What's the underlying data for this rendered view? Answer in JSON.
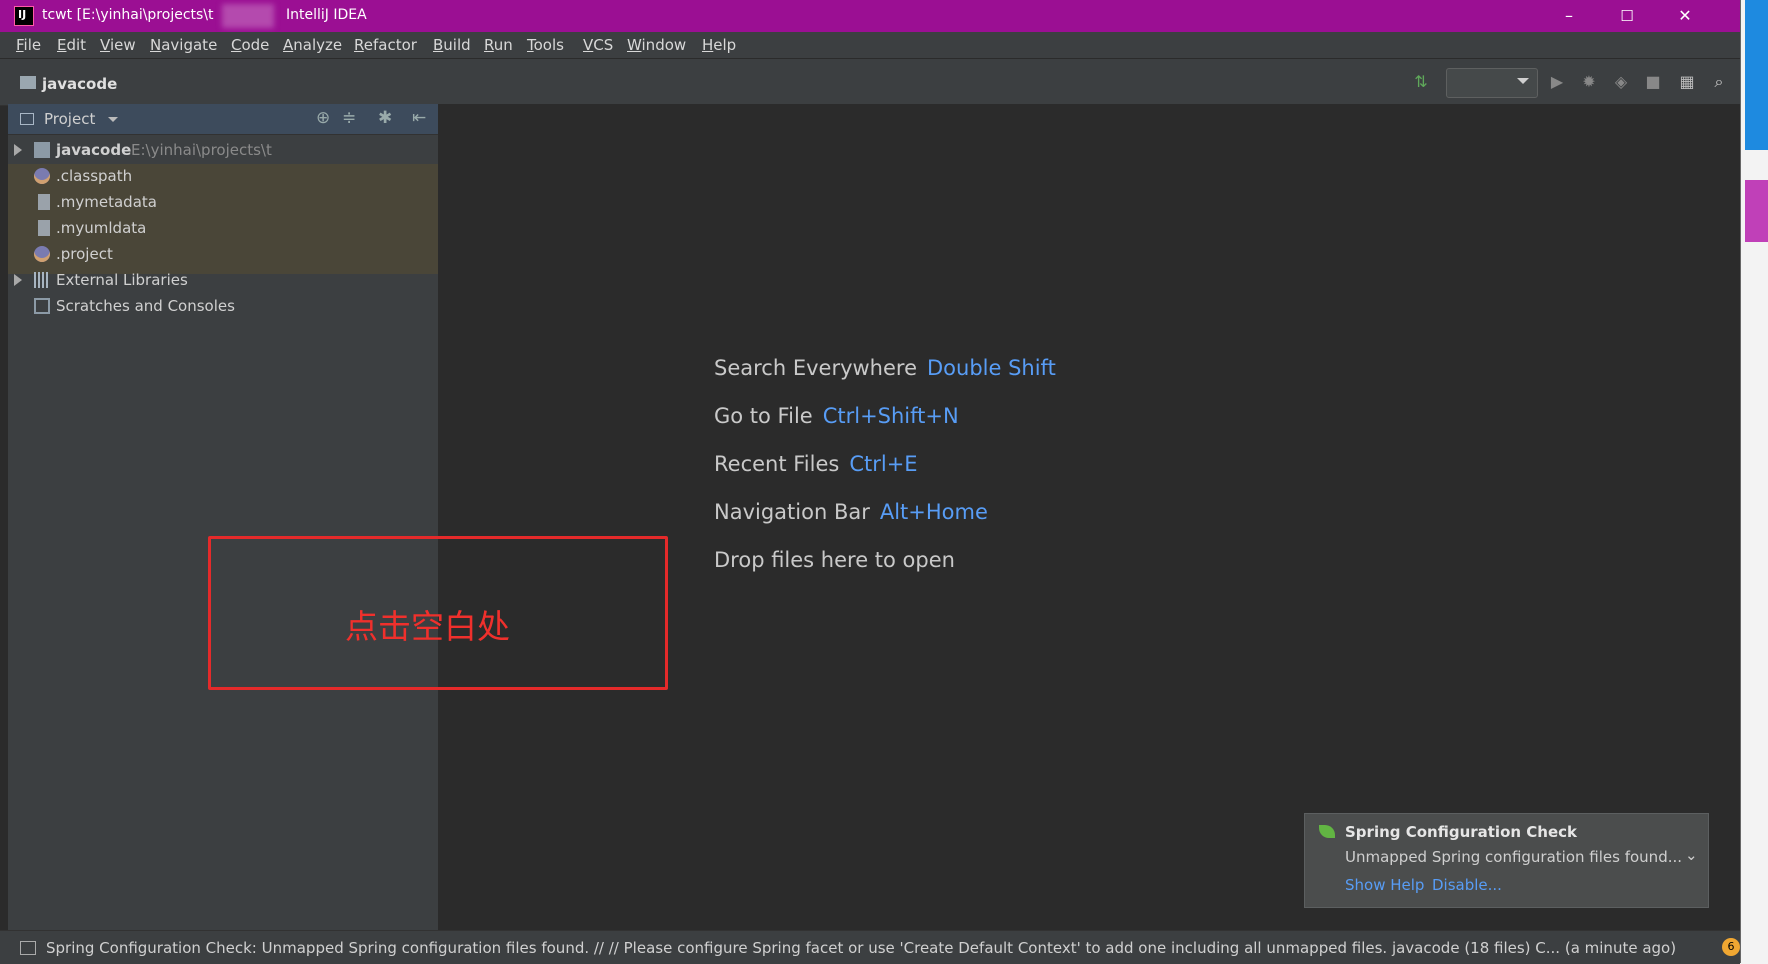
{
  "window": {
    "title": "tcwt [E:\\yinhai\\projects\\t",
    "app_name": "IntelliJ IDEA",
    "app_icon_letters": "IJ",
    "controls": {
      "minimize": "–",
      "maximize": "☐",
      "close": "✕"
    }
  },
  "menu": [
    "File",
    "Edit",
    "View",
    "Navigate",
    "Code",
    "Analyze",
    "Refactor",
    "Build",
    "Run",
    "Tools",
    "VCS",
    "Window",
    "Help"
  ],
  "breadcrumb": "javacode",
  "project_panel": {
    "title": "Project",
    "tree": [
      {
        "label": "javacode",
        "path": "E:\\yinhai\\projects\\t",
        "expandable": true,
        "icon": "folder-icon"
      },
      {
        "label": ".classpath",
        "icon": "eclipse-file-icon"
      },
      {
        "label": ".mymetadata",
        "icon": "file-icon"
      },
      {
        "label": ".myumldata",
        "icon": "file-icon"
      },
      {
        "label": ".project",
        "icon": "eclipse-file-icon"
      },
      {
        "label": "External Libraries",
        "expandable": true,
        "icon": "library-icon"
      },
      {
        "label": "Scratches and Consoles",
        "icon": "scratches-icon"
      }
    ]
  },
  "editor": {
    "hints": [
      {
        "text": "Search Everywhere",
        "shortcut": "Double Shift"
      },
      {
        "text": "Go to File",
        "shortcut": "Ctrl+Shift+N"
      },
      {
        "text": "Recent Files",
        "shortcut": "Ctrl+E"
      },
      {
        "text": "Navigation Bar",
        "shortcut": "Alt+Home"
      },
      {
        "text": "Drop files here to open",
        "shortcut": ""
      }
    ],
    "annotation": "点击空白处"
  },
  "notification": {
    "title": "Spring Configuration Check",
    "body": "Unmapped Spring configuration files found...",
    "links": {
      "help": "Show Help",
      "disable": "Disable..."
    }
  },
  "status_bar": {
    "message": "Spring Configuration Check: Unmapped Spring configuration files found. // // Please configure Spring facet or use 'Create Default Context' to add one including all unmapped files. javacode (18 files) C... (a minute ago)",
    "badge_count": "6"
  },
  "colors": {
    "titlebar": "#9b0f93",
    "link": "#589df6",
    "annotation_red": "#e52a2a"
  }
}
